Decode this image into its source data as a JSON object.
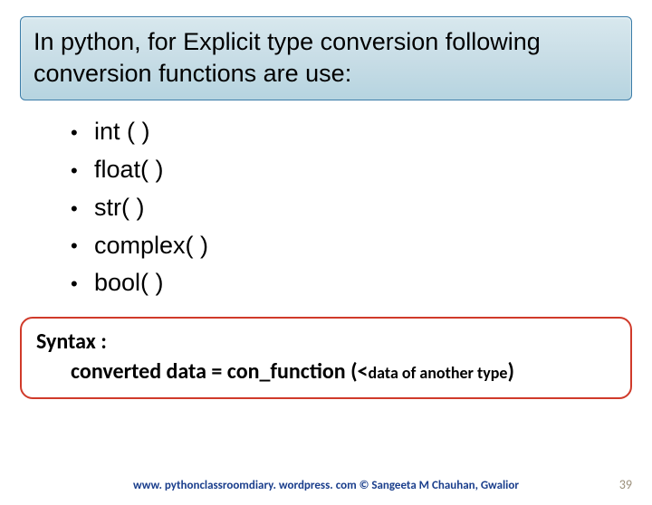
{
  "header": {
    "text": "In python, for Explicit type conversion following conversion functions are use:"
  },
  "bullets": [
    "int ( )",
    "float(  )",
    "str( )",
    "complex(  )",
    "bool(  )"
  ],
  "syntax": {
    "label": "Syntax :",
    "line_prefix": "converted data = con_function (<",
    "line_small": "data of another type",
    "line_suffix": ")"
  },
  "footer": {
    "text": "www. pythonclassroomdiary. wordpress. com ©  Sangeeta M Chauhan, Gwalior"
  },
  "page_number": "39"
}
